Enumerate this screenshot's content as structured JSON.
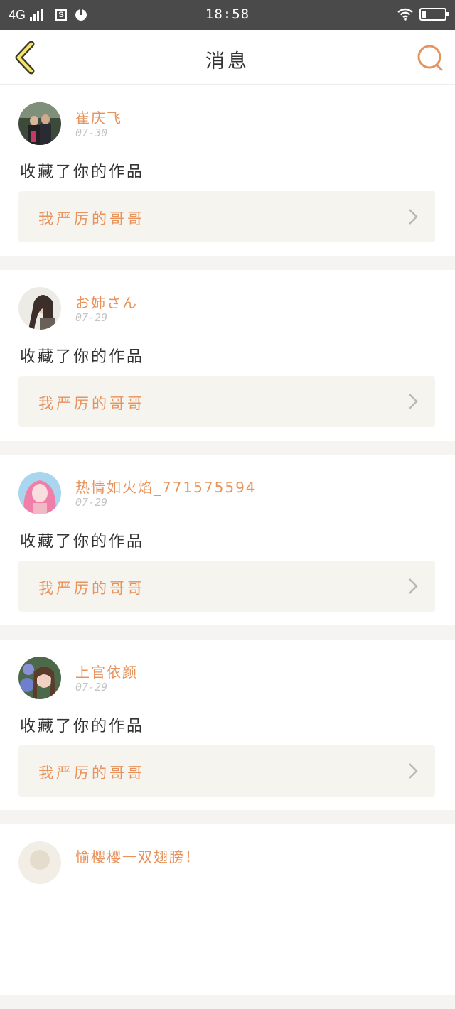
{
  "status_bar": {
    "network": "4G",
    "sim_icon_label": "S",
    "time": "18:58",
    "icons": [
      "signal-icon",
      "sim-icon",
      "app-icon",
      "wifi-icon",
      "battery-icon"
    ]
  },
  "nav": {
    "title": "消息",
    "back_icon": "back-chevron-icon",
    "search_icon": "search-icon",
    "accent_color": "#e8925c"
  },
  "messages": [
    {
      "name": "崔庆飞",
      "date": "07-30",
      "action": "收藏了你的作品",
      "work": "我严厉的哥哥"
    },
    {
      "name": "お姉さん",
      "date": "07-29",
      "action": "收藏了你的作品",
      "work": "我严厉的哥哥"
    },
    {
      "name": "热情如火焰_771575594",
      "date": "07-29",
      "action": "收藏了你的作品",
      "work": "我严厉的哥哥"
    },
    {
      "name": "上官依颜",
      "date": "07-29",
      "action": "收藏了你的作品",
      "work": "我严厉的哥哥"
    },
    {
      "name": "愉樱樱一双翅膀！",
      "date": "",
      "action": "",
      "work": ""
    }
  ]
}
